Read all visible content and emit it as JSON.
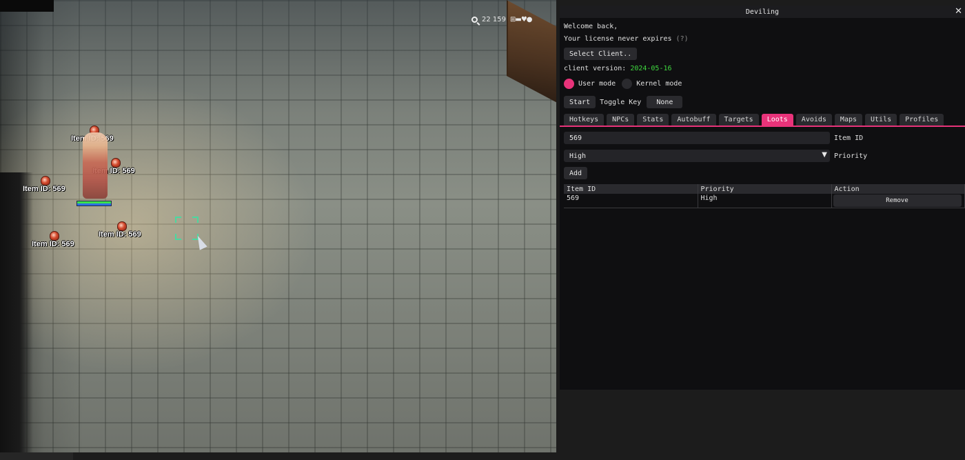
{
  "game": {
    "hud": {
      "icon": "search-icon",
      "zoom_text": "22 159",
      "status_glyphs": "⊞▬♥●"
    },
    "item_labels": [
      {
        "text": "Item ID: 569"
      },
      {
        "text": "Item ID: 569"
      },
      {
        "text": "Item ID: 569"
      },
      {
        "text": "Item ID: 569"
      },
      {
        "text": "Item ID: 569"
      }
    ],
    "character_hp_fraction": 1.0,
    "character_sp_fraction": 1.0
  },
  "panel": {
    "title": "Deviling",
    "close_symbol": "✕",
    "welcome": "Welcome back,",
    "license_text": "Your license never expires",
    "license_help": "(?)",
    "select_client_label": "Select Client..",
    "client_version_label": "client version:",
    "client_version_value": "2024-05-16",
    "modes": [
      {
        "label": "User mode",
        "selected": true
      },
      {
        "label": "Kernel mode",
        "selected": false
      }
    ],
    "start_label": "Start",
    "toggle_key_label": "Toggle Key",
    "toggle_key_value": "None",
    "tabs": [
      {
        "label": "Hotkeys"
      },
      {
        "label": "NPCs"
      },
      {
        "label": "Stats"
      },
      {
        "label": "Autobuff"
      },
      {
        "label": "Targets"
      },
      {
        "label": "Loots",
        "active": true
      },
      {
        "label": "Avoids"
      },
      {
        "label": "Maps"
      },
      {
        "label": "Utils"
      },
      {
        "label": "Profiles"
      }
    ],
    "loots": {
      "item_id_value": "569",
      "item_id_label": "Item ID",
      "priority_value": "High",
      "priority_label": "Priority",
      "add_label": "Add",
      "table": {
        "columns": [
          "Item ID",
          "Priority",
          "Action"
        ],
        "rows": [
          {
            "item_id": "569",
            "priority": "High",
            "action": "Remove"
          }
        ]
      }
    },
    "colors": {
      "accent": "#e8337a",
      "version_green": "#3fd93f",
      "panel_bg": "#0f0f11"
    }
  }
}
